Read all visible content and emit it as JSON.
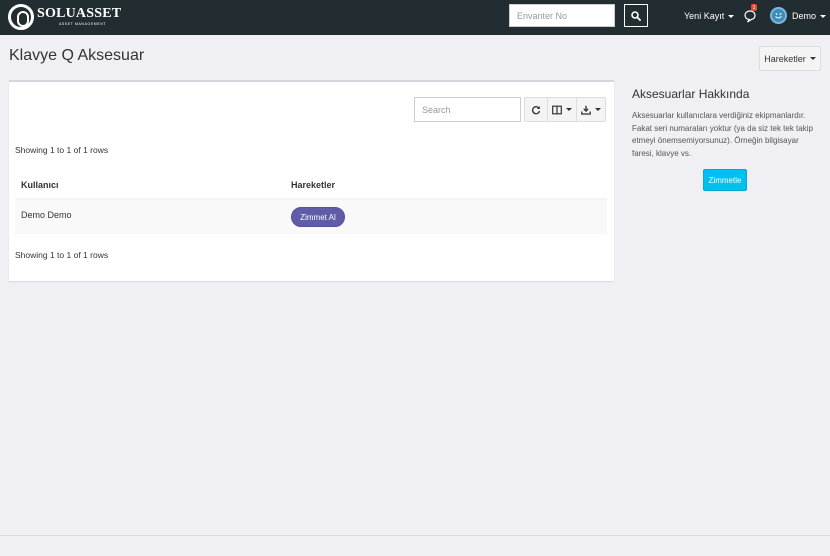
{
  "navbar": {
    "logo_name": "SOLUASSET",
    "logo_sub": "ASSET MANAGEMENT",
    "search_placeholder": "Envanter No",
    "new_record_label": "Yeni Kayıt",
    "notification_count": "1",
    "user_name": "Demo",
    "search_icon": "search-icon",
    "bell_icon": "comment-icon",
    "avatar_icon": "user-avatar-icon",
    "colors": {
      "navbar_bg": "#222d32",
      "badge": "#dd4b39"
    }
  },
  "page": {
    "title": "Klavye Q Aksesuar",
    "actions_label": "Hareketler"
  },
  "table_tools": {
    "search_placeholder": "Search",
    "refresh_icon": "refresh-icon",
    "columns_icon": "columns-icon",
    "export_icon": "download-icon"
  },
  "table": {
    "showing_top": "Showing 1 to 1 of 1 rows",
    "showing_bottom": "Showing 1 to 1 of 1 rows",
    "headers": [
      "Kullanıcı",
      "Hareketler"
    ],
    "rows": [
      {
        "user": "Demo Demo",
        "action_label": "Zimmet Al"
      }
    ],
    "colors": {
      "action_button": "#605ca8"
    }
  },
  "info": {
    "title": "Aksesuarlar Hakkında",
    "text": "Aksesuarlar kullanıclara verdiğiniz ekipmanlardır. Fakat seri numaraları yoktur (ya da siz tek tek takip etmeyi önemsemiyorsunuz). Örneğin bilgisayar faresi, klavye vs.",
    "button_label": "Zimmetle",
    "colors": {
      "button": "#00c0ef"
    }
  }
}
